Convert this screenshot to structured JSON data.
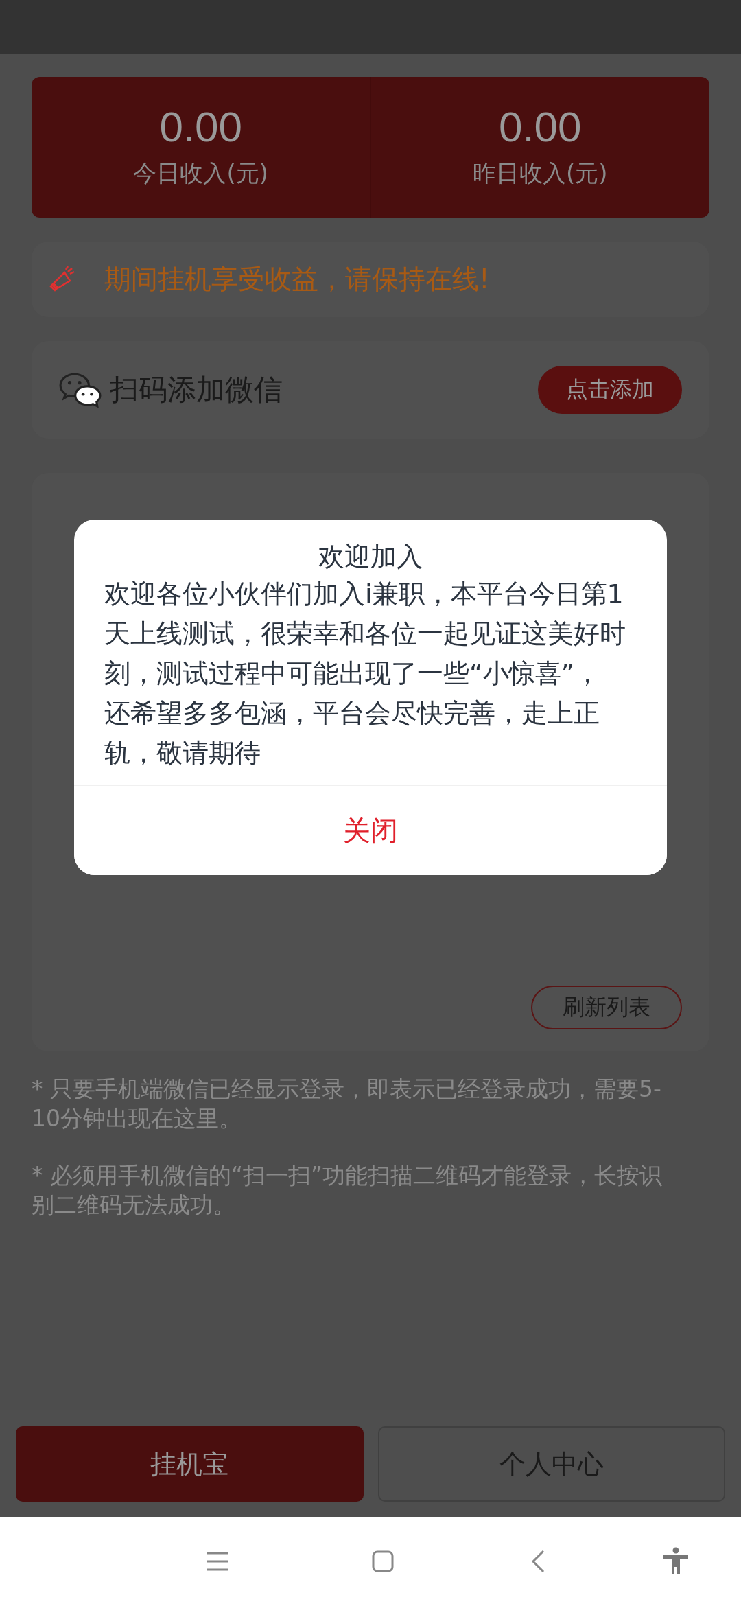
{
  "stats": [
    {
      "value": "0.00",
      "label": "今日收入(元)"
    },
    {
      "value": "0.00",
      "label": "昨日收入(元)"
    }
  ],
  "notice": {
    "text": "期间挂机享受收益，请保持在线!"
  },
  "wechat": {
    "label": "扫码添加微信",
    "button": "点击添加"
  },
  "list_card": {
    "refresh_button": "刷新列表"
  },
  "notes": [
    "* 只要手机端微信已经显示登录，即表示已经登录成功，需要5-10分钟出现在这里。",
    "* 必须用手机微信的“扫一扫”功能扫描二维码才能登录，长按识别二维码无法成功。"
  ],
  "tabs": [
    {
      "label": "挂机宝",
      "selected": true
    },
    {
      "label": "个人中心",
      "selected": false
    }
  ],
  "dialog": {
    "title": "欢迎加入",
    "body": "欢迎各位小伙伴们加入i兼职，本平台今日第1天上线测试，很荣幸和各位一起见证这美好时刻，测试过程中可能出现了一些“小惊喜”，还希望多多包涵，平台会尽快完善，走上正轨，敬请期待",
    "button": "关闭"
  }
}
